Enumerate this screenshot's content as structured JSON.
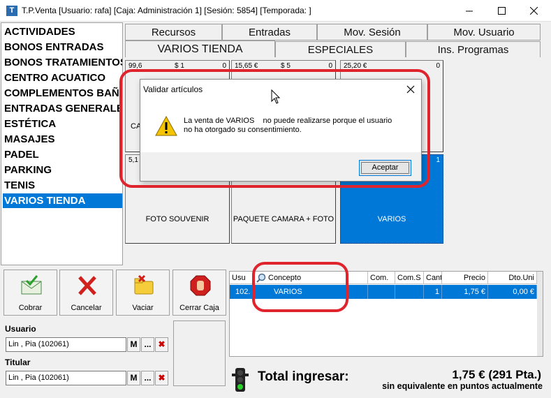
{
  "window": {
    "title": "T.P.Venta [Usuario: rafa] [Caja: Administración 1] [Sesión: 5854] [Temporada: ]"
  },
  "categories": [
    "ACTIVIDADES",
    "BONOS ENTRADAS",
    "BONOS TRATAMIENTOS",
    "CENTRO ACUATICO",
    "COMPLEMENTOS BAÑO",
    "ENTRADAS GENERALES",
    "ESTÉTICA",
    "MASAJES",
    "PADEL",
    "PARKING",
    "TENIS",
    "VARIOS TIENDA"
  ],
  "selected_category": "VARIOS TIENDA",
  "tabs_row1": [
    "Recursos",
    "Entradas",
    "Mov. Sesión",
    "Mov. Usuario"
  ],
  "tabs_row2": [
    "VARIOS TIENDA",
    "ESPECIALES",
    "Ins. Programas"
  ],
  "products_row1": [
    {
      "price": "99,6",
      "extra": "$ 1",
      "qty": "0",
      "label": "CA"
    },
    {
      "price": "15,65 €",
      "extra": "$ 5",
      "qty": "0",
      "label": ""
    },
    {
      "price": "25,20 €",
      "extra": "",
      "qty": "0",
      "label": ""
    }
  ],
  "products_row2": [
    {
      "price": "5,1",
      "qty": "",
      "label": "FOTO SOUVENIR"
    },
    {
      "price": "",
      "qty": "",
      "label": "PAQUETE CAMARA + FOTO"
    },
    {
      "price": "",
      "qty": "1",
      "label": "VARIOS"
    }
  ],
  "actions": [
    {
      "label": "Cobrar",
      "icon": "envelope-check-icon"
    },
    {
      "label": "Cancelar",
      "icon": "red-x-icon"
    },
    {
      "label": "Vaciar",
      "icon": "folder-x-icon"
    },
    {
      "label": "Cerrar Caja",
      "icon": "stop-hand-icon"
    }
  ],
  "usuario": {
    "label": "Usuario",
    "value": "Lin , Pia (102061)",
    "m": "M",
    "dots": "...",
    "x": "✖"
  },
  "titular": {
    "label": "Titular",
    "value": "Lin , Pia (102061)",
    "m": "M",
    "dots": "...",
    "x": "✖"
  },
  "grid": {
    "headers": [
      "Usu",
      "Concepto",
      "Com.",
      "Com.S",
      "Cant",
      "Precio",
      "Dto.Uni"
    ],
    "row": [
      "102.",
      "VARIOS",
      "",
      "",
      "1",
      "1,75 €",
      "0,00 €"
    ]
  },
  "total": {
    "label": "Total ingresar:",
    "value": "1,75 € (291 Pta.)",
    "points": "sin equivalente en puntos actualmente"
  },
  "dialog": {
    "title": "Validar artículos",
    "message_line1": "La venta de VARIOS    no puede realizarse porque el usuario",
    "message_line2": "no ha otorgado su consentimiento.",
    "ok": "Aceptar"
  },
  "colors": {
    "selection": "#0078d7",
    "highlight_ring": "#e0242e"
  }
}
